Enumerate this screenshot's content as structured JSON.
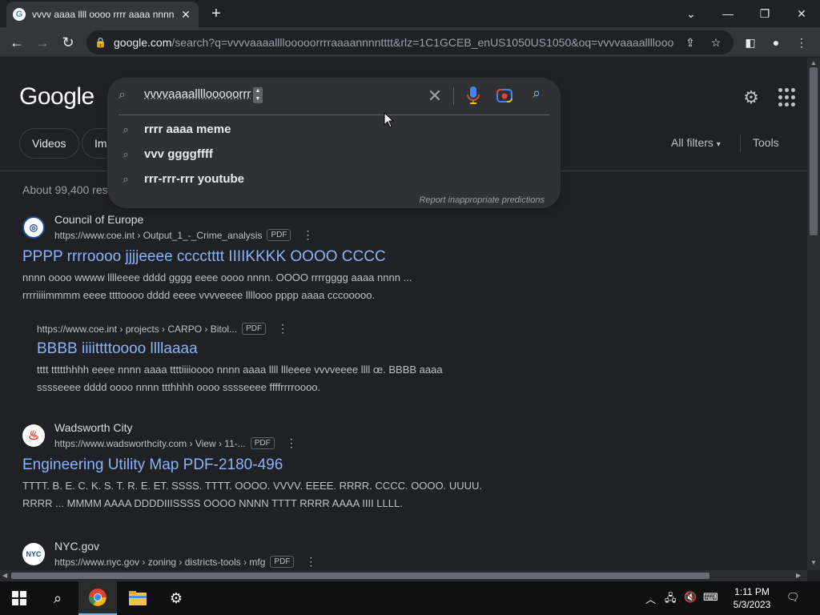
{
  "browser": {
    "tab_title": "vvvv aaaa llll oooo rrrr aaaa nnnn",
    "url_host": "google.com",
    "url_rest": "/search?q=vvvvaaaallllooooorrrraaaannnntttt&rlz=1C1GCEB_enUS1050US1050&oq=vvvvaaaallllooooor..."
  },
  "google": {
    "logo": "Google",
    "search_value": "vvvvaaaallllooooorrr",
    "suggestions": [
      "rrrr aaaa meme",
      "vvv ggggffff",
      "rrr-rrr-rrr youtube"
    ],
    "report_text": "Report inappropriate predictions",
    "chips": [
      "Videos",
      "Im"
    ],
    "all_filters": "All filters",
    "tools": "Tools",
    "stats": "About 99,400 res"
  },
  "results": [
    {
      "site": "Council of Europe",
      "url": "https://www.coe.int › Output_1_-_Crime_analysis",
      "badge": "PDF",
      "title": "PPPP rrrroooo jjjjeeee cccctttt IIIIKKKK OOOO CCCC",
      "snippet1": "nnnn oooo wwww lllleeee dddd gggg eeee oooo nnnn. OOOO rrrrgggg aaaa nnnn ...",
      "snippet2": "rrrriiiimmmm eeee ttttoooo dddd eeee vvvveeee llllooo pppp aaaa cccooooo."
    },
    {
      "url": "https://www.coe.int › projects › CARPO › Bitol...",
      "badge": "PDF",
      "title": "BBBB iiiittttoooo llllaaaa",
      "snippet1": "tttt ttttthhhh eeee nnnn aaaa ttttiiiioooo nnnn aaaa llll llleeee vvvveeee llll œ. BBBB aaaa",
      "snippet2": "sssseeee dddd oooo nnnn ttthhhh oooo sssseeee ffffrrrroooo."
    },
    {
      "site": "Wadsworth City",
      "url": "https://www.wadsworthcity.com › View › 11-...",
      "badge": "PDF",
      "title": "Engineering Utility Map PDF-2180-496",
      "snippet1": "TTTT. B. E. C. K. S. T. R. E. ET. SSSS. TTTT. OOOO. VVVV. EEEE. RRRR. CCCC. OOOO. UUUU.",
      "snippet2": "RRRR ... MMMM AAAA DDDDIIISSSS OOOO NNNN TTTT RRRR AAAA IIII LLLL."
    },
    {
      "site": "NYC.gov",
      "url": "https://www.nyc.gov › zoning › districts-tools › mfg",
      "badge": "PDF"
    }
  ],
  "taskbar": {
    "time": "1:11 PM",
    "date": "5/3/2023"
  },
  "icons": [
    "chrome-icon",
    "search-icon",
    "mic-icon",
    "lens-icon",
    "gear-icon",
    "apps-icon",
    "windows-icon",
    "file-explorer-icon",
    "settings-icon"
  ]
}
